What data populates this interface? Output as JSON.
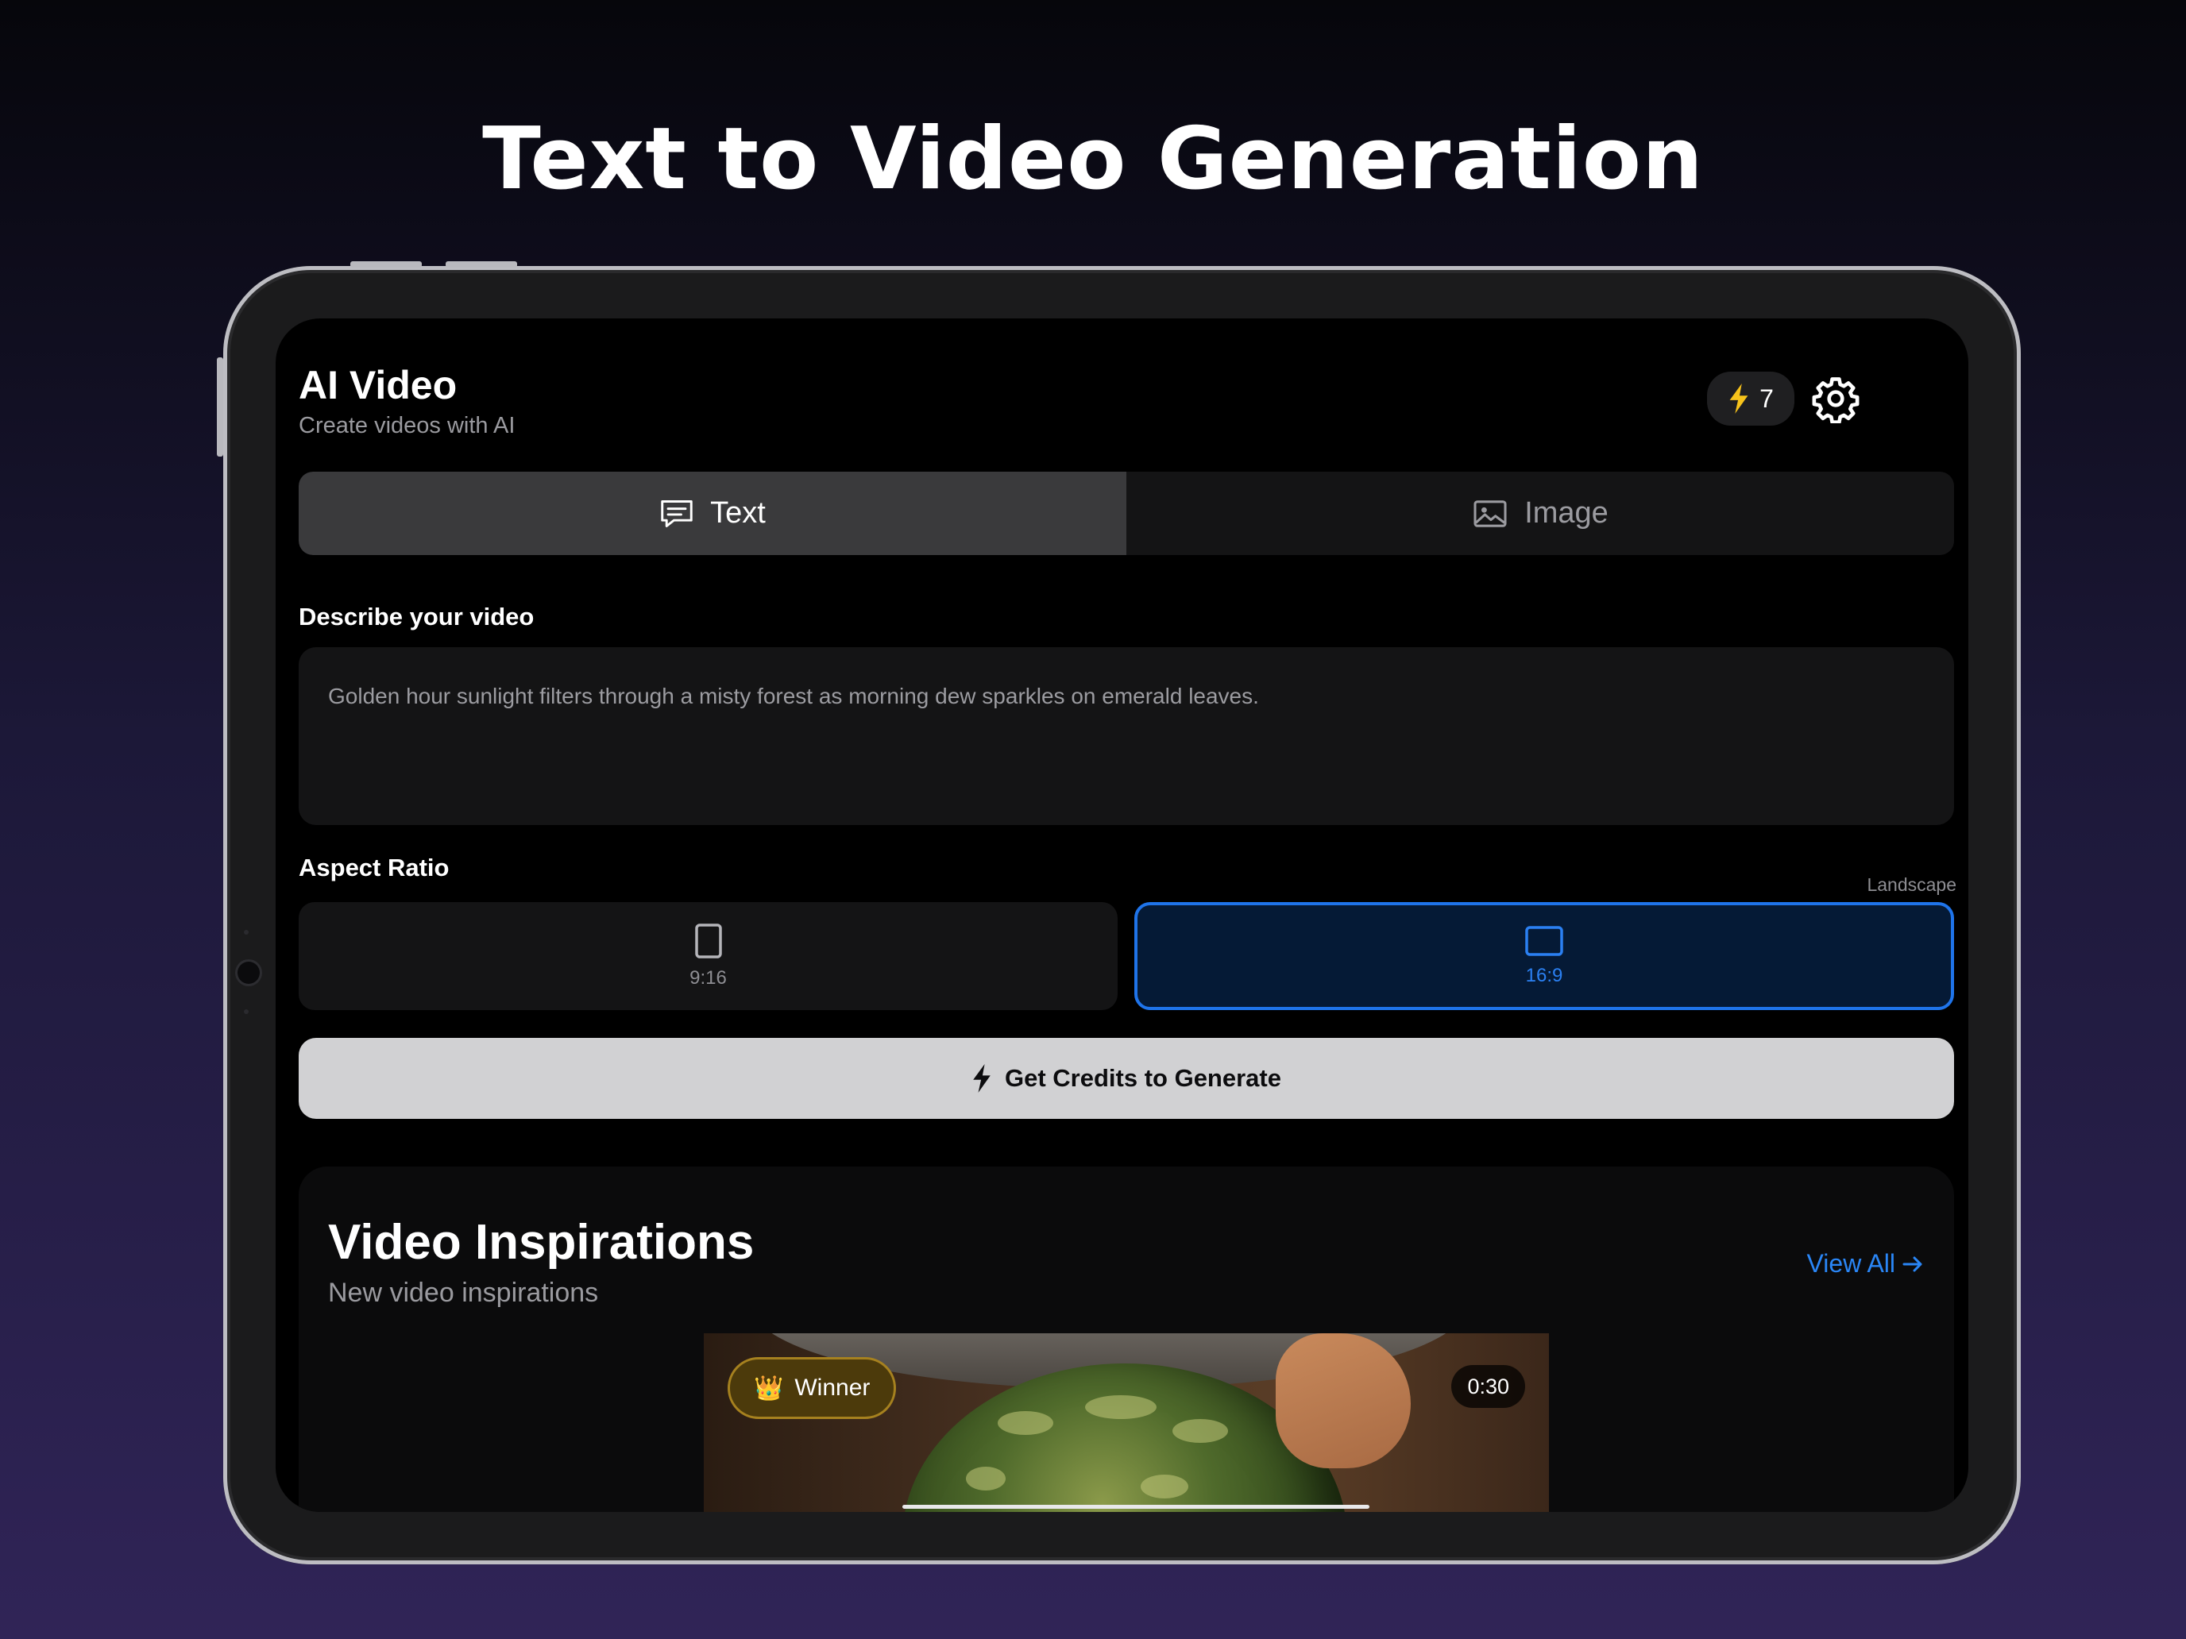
{
  "headline": "Text to Video Generation",
  "app": {
    "title": "AI Video",
    "subtitle": "Create videos with AI",
    "credits_count": "7",
    "credits_icon": "bolt-icon",
    "settings_icon": "gear-icon"
  },
  "mode_tabs": [
    {
      "label": "Text",
      "icon": "chat-bubble-icon",
      "selected": true
    },
    {
      "label": "Image",
      "icon": "photo-icon",
      "selected": false
    }
  ],
  "prompt": {
    "label": "Describe your video",
    "value": "Golden hour sunlight filters through a misty forest as morning dew sparkles on emerald leaves."
  },
  "aspect_ratio": {
    "label": "Aspect Ratio",
    "current": "Landscape",
    "options": [
      {
        "label": "9:16",
        "icon": "portrait-rect-icon",
        "selected": false
      },
      {
        "label": "16:9",
        "icon": "landscape-rect-icon",
        "selected": true
      }
    ]
  },
  "cta": {
    "label": "Get Credits to Generate",
    "icon": "bolt-icon"
  },
  "inspirations": {
    "title": "Video Inspirations",
    "subtitle": "New video inspirations",
    "view_all": "View All",
    "card": {
      "badge_emoji": "👑",
      "badge": "Winner",
      "duration": "0:30"
    }
  },
  "colors": {
    "accent_blue": "#1f74ea",
    "credits_bolt": "#f7c31b",
    "badge_gold": "#a6811f"
  }
}
